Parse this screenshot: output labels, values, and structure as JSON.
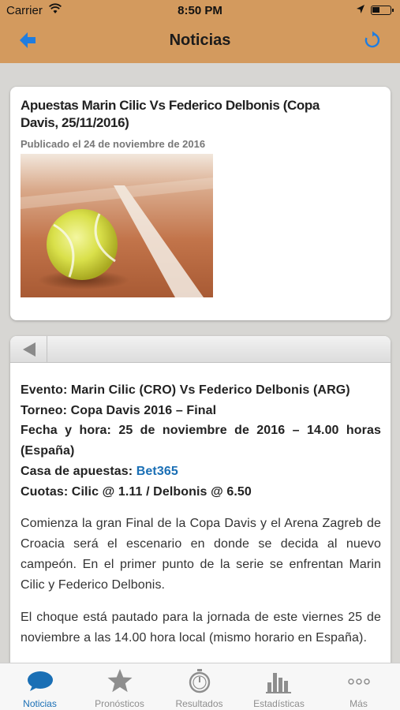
{
  "status_bar": {
    "carrier": "Carrier",
    "time": "8:50 PM"
  },
  "nav": {
    "title": "Noticias",
    "back_icon": "back-arrow-icon",
    "refresh_icon": "refresh-icon"
  },
  "article_card": {
    "title": "Apuestas Marin Cilic Vs Federico Delbonis (Copa Davis, 25/11/2016)",
    "published": "Publicado el 24 de noviembre de 2016",
    "image_icon": "tennis-ball-image"
  },
  "detail": {
    "toolbar_back_icon": "left-triangle-icon",
    "evento": "Evento: Marin Cilic (CRO) Vs Federico Delbonis (ARG)",
    "torneo": "Torneo: Copa Davis 2016 – Final",
    "fecha_line1": "Fecha y hora: 25 de noviembre de 2016 – 14.00 horas",
    "fecha_line2": "(España)",
    "casa_label": "Casa de apuestas: ",
    "casa_link": "Bet365",
    "cuotas": "Cuotas: Cilic @ 1.11 / Delbonis @ 6.50",
    "paragraph1": "Comienza la gran Final de la Copa Davis y el Arena Zagreb de Croacia será el escenario en donde se decida al nuevo campeón. En el primer punto de la serie se enfrentan Marin Cilic y Federico Delbonis.",
    "paragraph2": "El choque está pautado para la jornada de este viernes 25 de noviembre a las 14.00 hora local (mismo horario en España)."
  },
  "tabs": [
    {
      "label": "Noticias",
      "icon": "speech-bubble-icon",
      "active": true
    },
    {
      "label": "Pronósticos",
      "icon": "star-icon",
      "active": false
    },
    {
      "label": "Resultados",
      "icon": "stopwatch-icon",
      "active": false
    },
    {
      "label": "Estadísticas",
      "icon": "bar-chart-icon",
      "active": false
    },
    {
      "label": "Más",
      "icon": "more-dots-icon",
      "active": false
    }
  ],
  "colors": {
    "nav_bar": "#d39a5e",
    "accent_blue": "#1a6fb5",
    "background": "#d7d6d3"
  }
}
